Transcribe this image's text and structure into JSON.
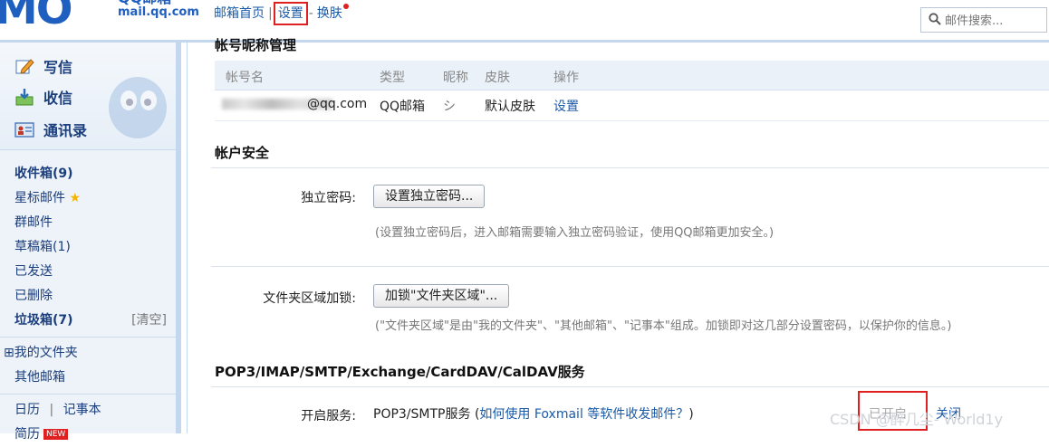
{
  "header": {
    "logo_big": "MO",
    "logo_brand": "QQ邮箱",
    "logo_url": "mail.qq.com",
    "nav": {
      "home": "邮箱首页",
      "sep": "|",
      "settings": "设置",
      "dash": "-",
      "skin": "换肤"
    },
    "search_placeholder": "邮件搜索..."
  },
  "sidebar": {
    "actions": {
      "compose": "写信",
      "receive": "收信",
      "contacts": "通讯录"
    },
    "folders": [
      {
        "label": "收件箱(9)"
      },
      {
        "label": "星标邮件"
      },
      {
        "label": "群邮件"
      },
      {
        "label": "草稿箱(1)"
      },
      {
        "label": "已发送"
      },
      {
        "label": "已删除"
      },
      {
        "label": "垃圾箱(7)",
        "action": "[清空]"
      }
    ],
    "my_folders": "⊞我的文件夹",
    "other_mail": "其他邮箱",
    "tools": {
      "calendar": "日历",
      "sep": "|",
      "notebook": "记事本",
      "resume": "简历",
      "new_badge": "NEW"
    }
  },
  "main": {
    "account_section_title": "帐号昵称管理",
    "account_table": {
      "headers": [
        "帐号名",
        "类型",
        "昵称",
        "皮肤",
        "操作"
      ],
      "row": {
        "account_suffix": "@qq.com",
        "type": "QQ邮箱",
        "nickname": "シ",
        "skin": "默认皮肤",
        "action": "设置"
      }
    },
    "security": {
      "title": "帐户安全",
      "independent_password_label": "独立密码:",
      "independent_password_button": "设置独立密码...",
      "independent_password_hint": "(设置独立密码后，进入邮箱需要输入独立密码验证，使用QQ邮箱更加安全。)",
      "folder_lock_label": "文件夹区域加锁:",
      "folder_lock_button": "加锁\"文件夹区域\"...",
      "folder_lock_hint": "(\"文件夹区域\"是由\"我的文件夹\"、\"其他邮箱\"、\"记事本\"组成。加锁即对这几部分设置密码，以保护你的信息。)"
    },
    "pop3": {
      "title": "POP3/IMAP/SMTP/Exchange/CardDAV/CalDAV服务",
      "enable_label": "开启服务:",
      "service_name": "POP3/SMTP服务",
      "help_prefix": "(",
      "help_link": "如何使用 Foxmail 等软件收发邮件？",
      "help_suffix": ")",
      "status": "已开启",
      "close": "关闭"
    }
  },
  "watermark": "CSDN @醉几尘- World1y"
}
